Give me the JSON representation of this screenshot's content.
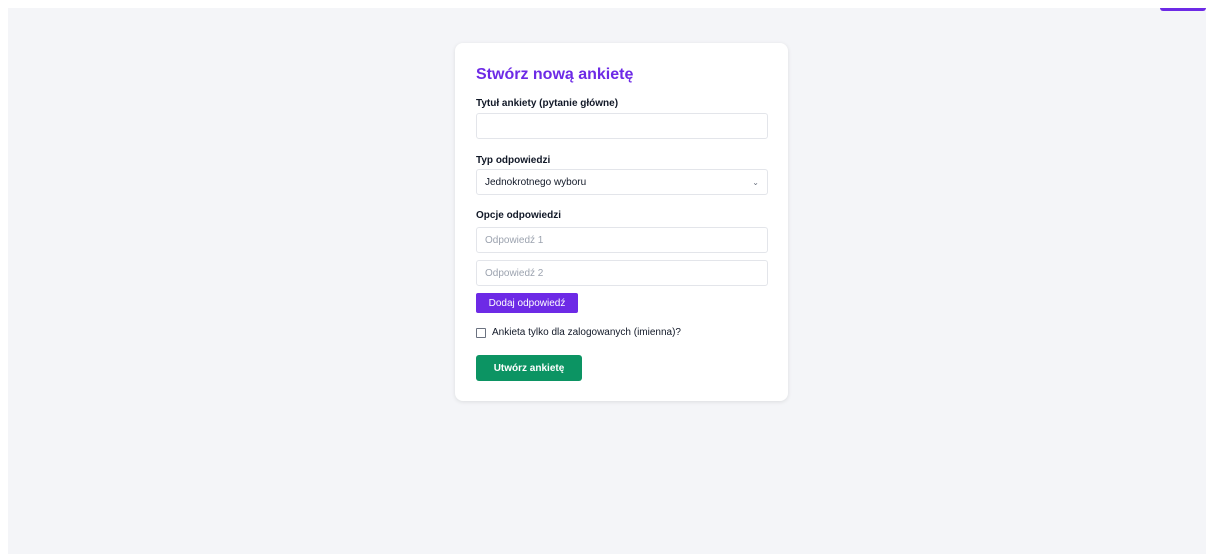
{
  "form": {
    "title": "Stwórz nową ankietę",
    "survey_title_label": "Tytuł ankiety (pytanie główne)",
    "survey_title_value": "",
    "answer_type_label": "Typ odpowiedzi",
    "answer_type_selected": "Jednokrotnego wyboru",
    "options_label": "Opcje odpowiedzi",
    "options": [
      {
        "placeholder": "Odpowiedź 1",
        "value": ""
      },
      {
        "placeholder": "Odpowiedź 2",
        "value": ""
      }
    ],
    "add_option_label": "Dodaj odpowiedź",
    "logged_only_label": "Ankieta tylko dla zalogowanych (imienna)?",
    "logged_only_checked": false,
    "submit_label": "Utwórz ankietę"
  },
  "icons": {
    "select_chevron": "chevron-down-icon"
  },
  "colors": {
    "background": "#f4f5f8",
    "card": "#ffffff",
    "accent_purple": "#6d2ae6",
    "submit_green": "#0c9463",
    "border": "#e3e5ea"
  }
}
